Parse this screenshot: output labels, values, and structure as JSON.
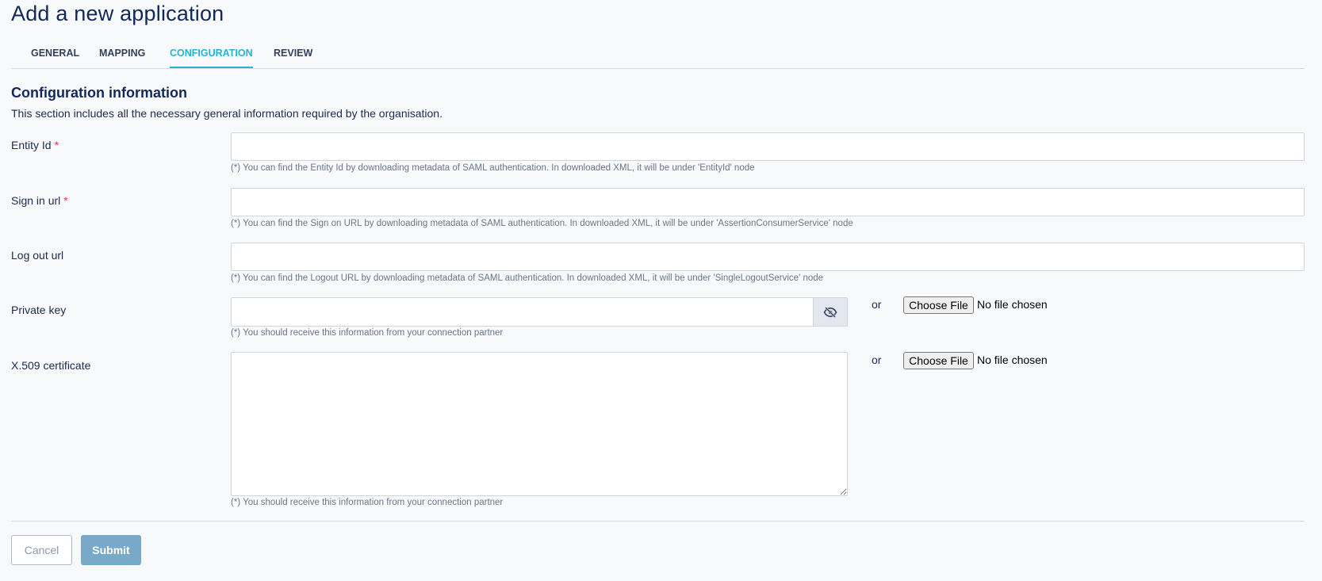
{
  "page": {
    "title": "Add a new application"
  },
  "tabs": [
    {
      "label": "GENERAL",
      "active": false
    },
    {
      "label": "MAPPING",
      "active": false
    },
    {
      "label": "CONFIGURATION",
      "active": true
    },
    {
      "label": "REVIEW",
      "active": false
    }
  ],
  "section": {
    "title": "Configuration information",
    "description": "This section includes all the necessary general information required by the organisation."
  },
  "fields": {
    "entity_id": {
      "label": "Entity Id",
      "required_marker": "*",
      "value": "",
      "hint": "(*) You can find the Entity Id by downloading metadata of SAML authentication. In downloaded XML, it will be under 'EntityId' node"
    },
    "sign_in_url": {
      "label": "Sign in url",
      "required_marker": "*",
      "value": "",
      "hint": "(*) You can find the Sign on URL by downloading metadata of SAML authentication. In downloaded XML, it will be under 'AssertionConsumerService' node"
    },
    "log_out_url": {
      "label": "Log out url",
      "value": "",
      "hint": "(*) You can find the Logout URL by downloading metadata of SAML authentication. In downloaded XML, it will be under 'SingleLogoutService' node"
    },
    "private_key": {
      "label": "Private key",
      "value": "",
      "toggle_icon": "eye-slash-icon",
      "hint": "(*) You should receive this information from your connection partner",
      "or_text": "or",
      "file_button": "Choose File",
      "file_status": "No file chosen"
    },
    "certificate": {
      "label": "X.509 certificate",
      "value": "",
      "hint": "(*) You should receive this information from your connection partner",
      "or_text": "or",
      "file_button": "Choose File",
      "file_status": "No file chosen"
    }
  },
  "actions": {
    "cancel_label": "Cancel",
    "submit_label": "Submit"
  },
  "colors": {
    "title": "#12275a",
    "active_tab": "#25b4d6",
    "required": "#e0364b",
    "submit_bg": "#78a9c8"
  }
}
